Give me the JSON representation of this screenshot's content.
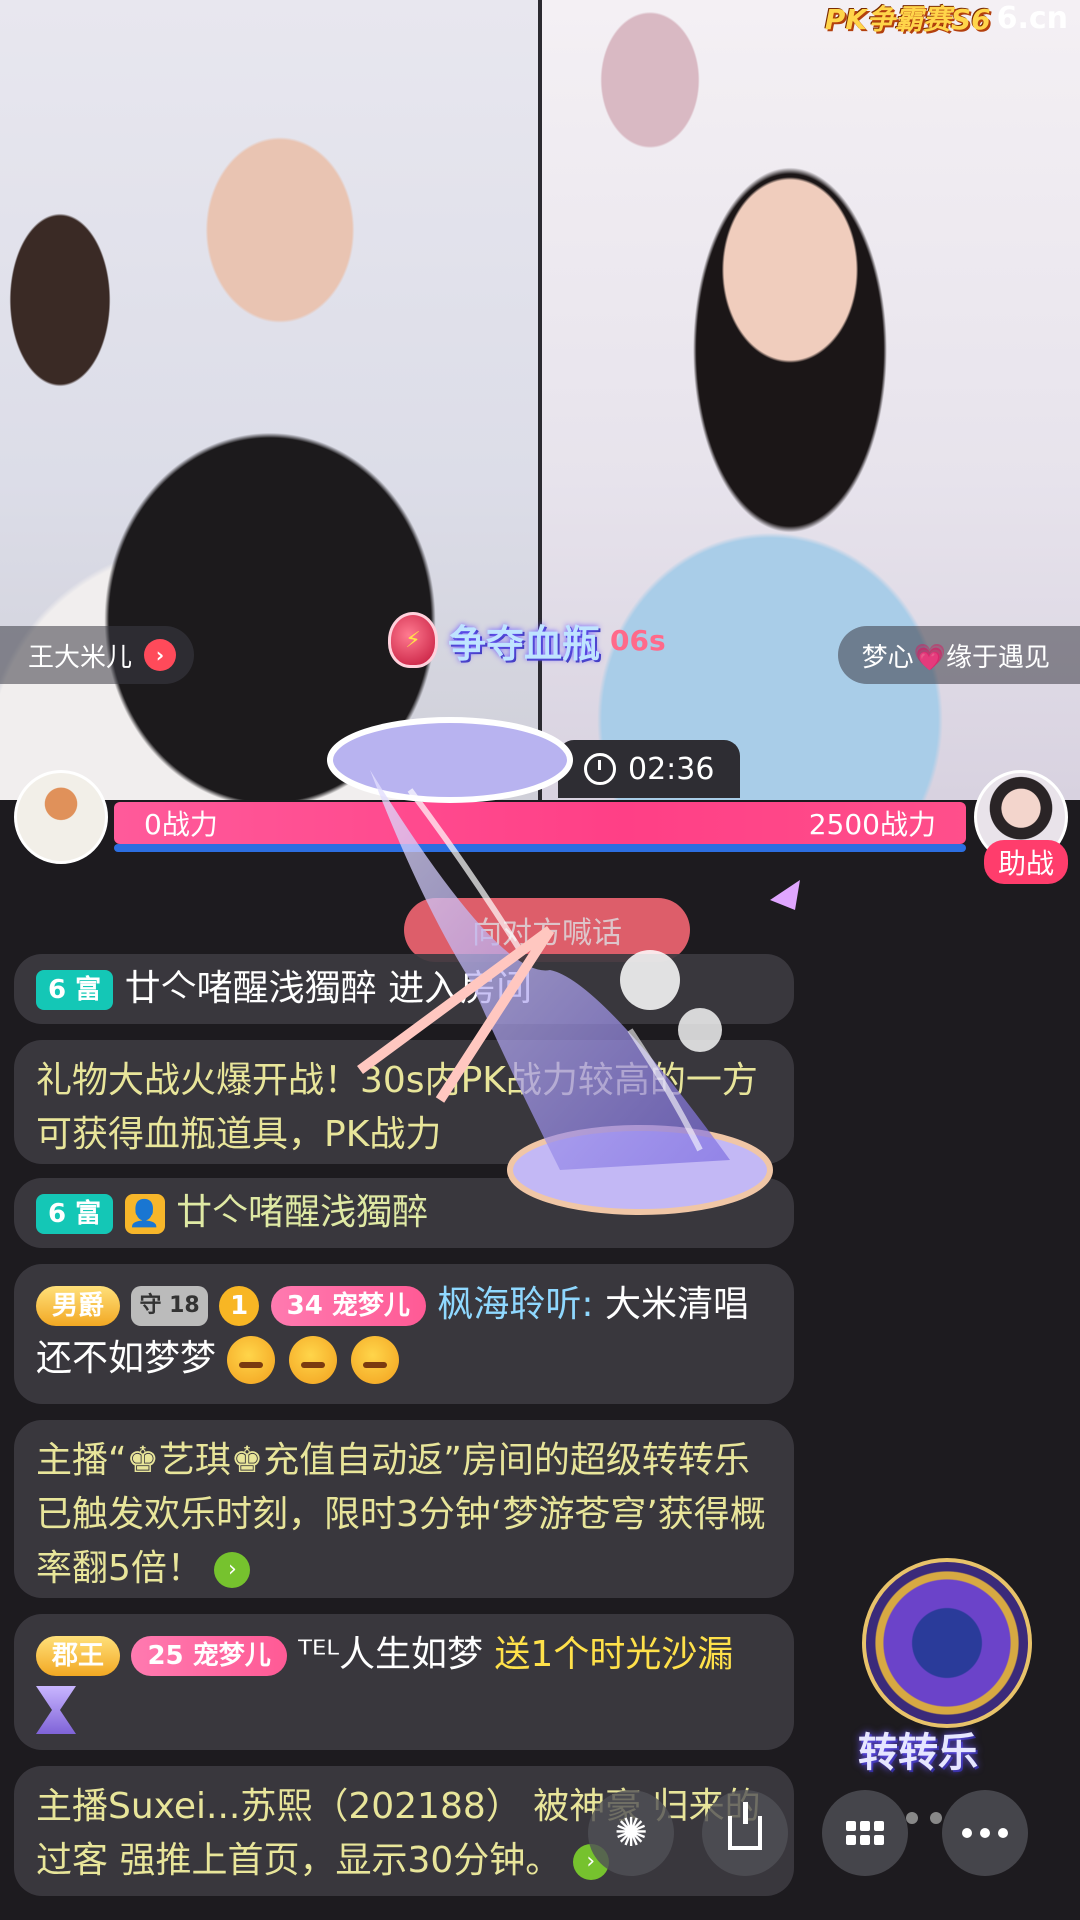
{
  "brand": {
    "pk_label": "PK争霸赛S6",
    "site": "6.cn"
  },
  "streamers": {
    "left_name": "王大米儿",
    "right_name": "梦心💗缘于遇见"
  },
  "event": {
    "title": "争夺血瓶",
    "countdown": "06s"
  },
  "timer": {
    "value": "02:36"
  },
  "pk": {
    "left_power": "0战力",
    "right_power": "2500战力",
    "help_label": "助战",
    "left_fraction": 0.0
  },
  "shout_label": "向对方喊话",
  "chat": [
    {
      "badges": [
        "6 富"
      ],
      "user": "廿亽啫醒浅獨醉",
      "text": "进入房间"
    },
    {
      "system": "礼物大战火爆开战！30s内PK战力较高的一方可获得血瓶道具，PK战力"
    },
    {
      "badges": [
        "6 富"
      ],
      "user": "廿亽啫醒浅獨醉"
    },
    {
      "badges": [
        "男爵",
        "守 18",
        "1",
        "34 宠梦儿"
      ],
      "user": "枫海聆听:",
      "text": "大米清唱还不如梦梦"
    },
    {
      "system": "主播“♚艺琪♚充值自动返”房间的超级转转乐已触发欢乐时刻，限时3分钟‘梦游苍穹’获得概率翻5倍！"
    },
    {
      "badges": [
        "郡王",
        "25 宠梦儿"
      ],
      "user": "ᵀᴱᴸ人生如梦",
      "gift": "送1个时光沙漏"
    },
    {
      "system": "主播Suxei...苏熙（202188） 被神豪 归来的过客 强推上首页，显示30分钟。"
    }
  ],
  "wheel": {
    "label": "转转乐"
  },
  "icons": [
    "sparkle-icon",
    "download-icon",
    "grid-icon",
    "more-icon",
    "clock-icon"
  ]
}
